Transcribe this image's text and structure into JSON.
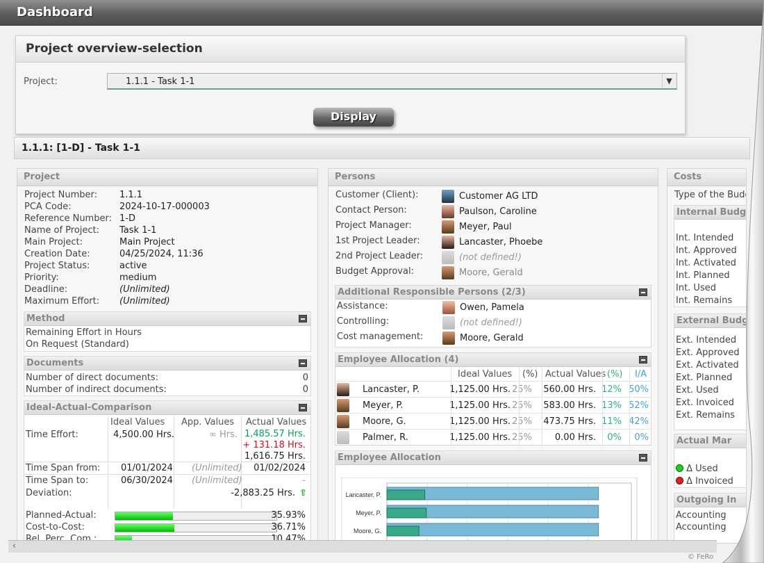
{
  "header": {
    "title": "Dashboard"
  },
  "selection": {
    "title": "Project overview-selection",
    "project_label": "Project:",
    "project_value": "1.1.1 - Task 1-1",
    "display_label": "Display"
  },
  "task_title": "1.1.1: [1-D] - Task 1-1",
  "project": {
    "heading": "Project",
    "fields": [
      {
        "label": "Project Number:",
        "value": "1.1.1"
      },
      {
        "label": "PCA Code:",
        "value": "2024-10-17-000003"
      },
      {
        "label": "Reference Number:",
        "value": "1-D"
      },
      {
        "label": "Name of Project:",
        "value": "Task 1-1"
      },
      {
        "label": "Main Project:",
        "value": "Main Project"
      },
      {
        "label": "Creation Date:",
        "value": "04/25/2024, 11:36"
      },
      {
        "label": "Project Status:",
        "value": "active"
      },
      {
        "label": "Priority:",
        "value": "medium"
      },
      {
        "label": "Deadline:",
        "value": "(Unlimited)"
      },
      {
        "label": "Maximum Effort:",
        "value": "(Unlimited)"
      }
    ],
    "method": {
      "heading": "Method",
      "lines": [
        "Remaining Effort in Hours",
        "On Request (Standard)"
      ]
    },
    "documents": {
      "heading": "Documents",
      "rows": [
        {
          "label": "Number of direct documents:",
          "value": "0"
        },
        {
          "label": "Number of indirect documents:",
          "value": "0"
        }
      ]
    },
    "iac": {
      "heading": "Ideal-Actual-Comparison",
      "cols": [
        "Ideal Values",
        "App. Values",
        "Actual Values"
      ],
      "time_effort_label": "Time Effort:",
      "ideal": "4,500.00 Hrs.",
      "app": "∞ Hrs.",
      "actual1": "1,485.57 Hrs.",
      "actual2": "+ 131.18 Hrs.",
      "actual3": "1,616.75 Hrs.",
      "span_from_label": "Time Span from:",
      "span_from_ideal": "01/01/2024",
      "span_from_app": "(Unlimited)",
      "span_from_actual": "01/02/2024",
      "span_to_label": "Time Span to:",
      "span_to_ideal": "06/30/2024",
      "span_to_app": "(Unlimited)",
      "span_to_actual": "-",
      "deviation_label": "Deviation:",
      "deviation_value": "-2,883.25 Hrs.",
      "bars": [
        {
          "label": "Planned-Actual:",
          "value": "35.93%",
          "fill": 0.3593
        },
        {
          "label": "Cost-to-Cost:",
          "value": "36.71%",
          "fill": 0.3671
        },
        {
          "label": "Rel. Perc. Com.:",
          "value": "10.47%",
          "fill": 0.1047
        }
      ]
    }
  },
  "persons": {
    "heading": "Persons",
    "rows": [
      {
        "label": "Customer (Client):",
        "value": "Customer AG LTD",
        "defined": true
      },
      {
        "label": "Contact Person:",
        "value": "Paulson, Caroline",
        "defined": true
      },
      {
        "label": "Project Manager:",
        "value": "Meyer, Paul",
        "defined": true
      },
      {
        "label": "1st Project Leader:",
        "value": "Lancaster, Phoebe",
        "defined": true
      },
      {
        "label": "2nd Project Leader:",
        "value": "(not defined!)",
        "defined": false
      },
      {
        "label": "Budget Approval:",
        "value": "Moore, Gerald",
        "defined": true
      }
    ],
    "additional": {
      "heading": "Additional Responsible Persons (2/3)",
      "rows": [
        {
          "label": "Assistance:",
          "value": "Owen, Pamela"
        },
        {
          "label": "Controlling:",
          "value": "(not defined!)"
        },
        {
          "label": "Cost management:",
          "value": "Moore, Gerald"
        }
      ]
    },
    "allocation": {
      "heading": "Employee Allocation (4)",
      "cols": [
        "Ideal Values",
        "(%)",
        "Actual Values",
        "(%)",
        "I/A"
      ],
      "rows": [
        {
          "name": "Lancaster, P.",
          "ideal": "1,125.00 Hrs.",
          "pct": "25%",
          "actual": "560.00 Hrs.",
          "apct": "12%",
          "ia": "50%"
        },
        {
          "name": "Meyer, P.",
          "ideal": "1,125.00 Hrs.",
          "pct": "25%",
          "actual": "583.00 Hrs.",
          "apct": "13%",
          "ia": "52%"
        },
        {
          "name": "Moore, G.",
          "ideal": "1,125.00 Hrs.",
          "pct": "25%",
          "actual": "473.75 Hrs.",
          "apct": "11%",
          "ia": "42%"
        },
        {
          "name": "Palmer, R.",
          "ideal": "1,125.00 Hrs.",
          "pct": "25%",
          "actual": "0.00 Hrs.",
          "apct": "0%",
          "ia": "0%"
        }
      ]
    },
    "allocation_chart": {
      "heading": "Employee Allocation"
    }
  },
  "costs": {
    "heading": "Costs",
    "type_label": "Type of the Budg",
    "internal": {
      "heading": "Internal Budge",
      "rows": [
        "Int. Intended",
        "Int. Approved",
        "Int. Activated",
        "Int. Planned",
        "Int. Used",
        "Int. Remains"
      ]
    },
    "external": {
      "heading": "External Budg",
      "rows": [
        "Ext. Intended",
        "Ext. Approved",
        "Ext. Activated",
        "Ext. Planned",
        "Ext. Used",
        "Ext. Invoiced",
        "Ext. Remains"
      ]
    },
    "actual": {
      "heading": "Actual Mar",
      "rows": [
        "Δ Used",
        "Δ Invoiced"
      ]
    },
    "outgoing": {
      "heading": "Outgoing In",
      "rows": [
        "Accounting",
        "Accounting"
      ]
    }
  },
  "chart_data": {
    "type": "bar",
    "categories": [
      "Lancaster, P.",
      "Meyer, P.",
      "Moore, G."
    ],
    "series": [
      {
        "values": [
          1125,
          1125,
          1125
        ]
      },
      {
        "values": [
          560,
          583,
          473.75
        ]
      }
    ]
  },
  "footer": {
    "copyright": "© FeRo"
  },
  "colors": {
    "accent_green": "#0aa05a",
    "warn_red": "#cc1122",
    "percent_blue": "#4a9fd0",
    "percent_green": "#33b07a"
  }
}
